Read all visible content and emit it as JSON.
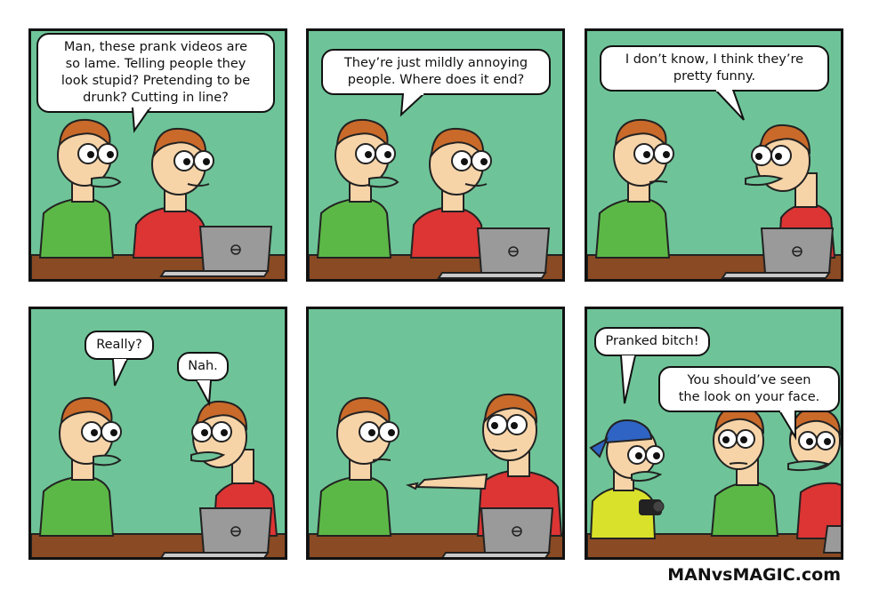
{
  "comic": {
    "credit": "MANvsMAGIC.com",
    "colors": {
      "background": "#6ec498",
      "table": "#8a4a23",
      "green_shirt": "#5cb846",
      "red_shirt": "#dd3434",
      "yellow_shirt": "#d9e12a",
      "cap": "#2f64c4",
      "skin": "#f7d4a8",
      "hair": "#c96a2a",
      "laptop": "#999999"
    },
    "panels": [
      {
        "bubbles": [
          {
            "text": "Man, these prank videos are\nso lame. Telling people they\nlook stupid? Pretending to be\ndrunk? Cutting in line?"
          }
        ]
      },
      {
        "bubbles": [
          {
            "text": "They’re just mildly annoying\npeople. Where does it end?"
          }
        ]
      },
      {
        "bubbles": [
          {
            "text": "I don’t know, I think they’re\npretty funny."
          }
        ]
      },
      {
        "bubbles": [
          {
            "text": "Really?"
          },
          {
            "text": "Nah."
          }
        ]
      },
      {
        "bubbles": []
      },
      {
        "bubbles": [
          {
            "text": "Pranked bitch!"
          },
          {
            "text": "You should’ve seen\nthe look on your face."
          }
        ]
      }
    ]
  }
}
